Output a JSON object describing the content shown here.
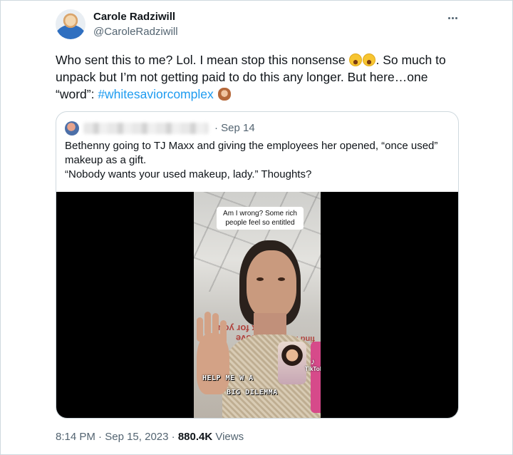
{
  "tweet": {
    "author_name": "Carole Radziwill",
    "author_handle": "@CaroleRadziwill",
    "more_icon": "more-horizontal-icon",
    "text_before": "Who sent this to me? Lol. I mean stop this nonsense ",
    "emoji_1": "face-with-tears-of-joy",
    "emoji_2": "face-with-tears-of-joy",
    "text_middle": ". So much to unpack but I’m not getting paid to do this any longer. But here…one “word”: ",
    "hashtag": "#whitesaviorcomplex",
    "emoji_3": "see-no-evil-monkey",
    "time": "8:14 PM",
    "date": "Sep 15, 2023",
    "views_count": "880.4K",
    "views_label": "Views",
    "separator": "·"
  },
  "quote": {
    "author_blurred": true,
    "date": "Sep 14",
    "line1": "Bethenny going to TJ Maxx and giving the employees her opened, “once used” makeup as a gift.",
    "line2": "“Nobody wants your used makeup, lady.” Thoughts?",
    "video": {
      "overlay_text": "Am I wrong? Some rich people feel so entitled",
      "caption_line1": "HELP ME W A",
      "caption_line2": "BIG DILEMMA",
      "wall_text_1": "you love",
      "wall_text_2": "work for you.",
      "wall_text_3": "find it",
      "watermark": "TikTok"
    }
  },
  "colors": {
    "link": "#1d9bf0",
    "secondary_text": "#536471",
    "primary_text": "#0f1419",
    "border": "#cfd9de"
  }
}
